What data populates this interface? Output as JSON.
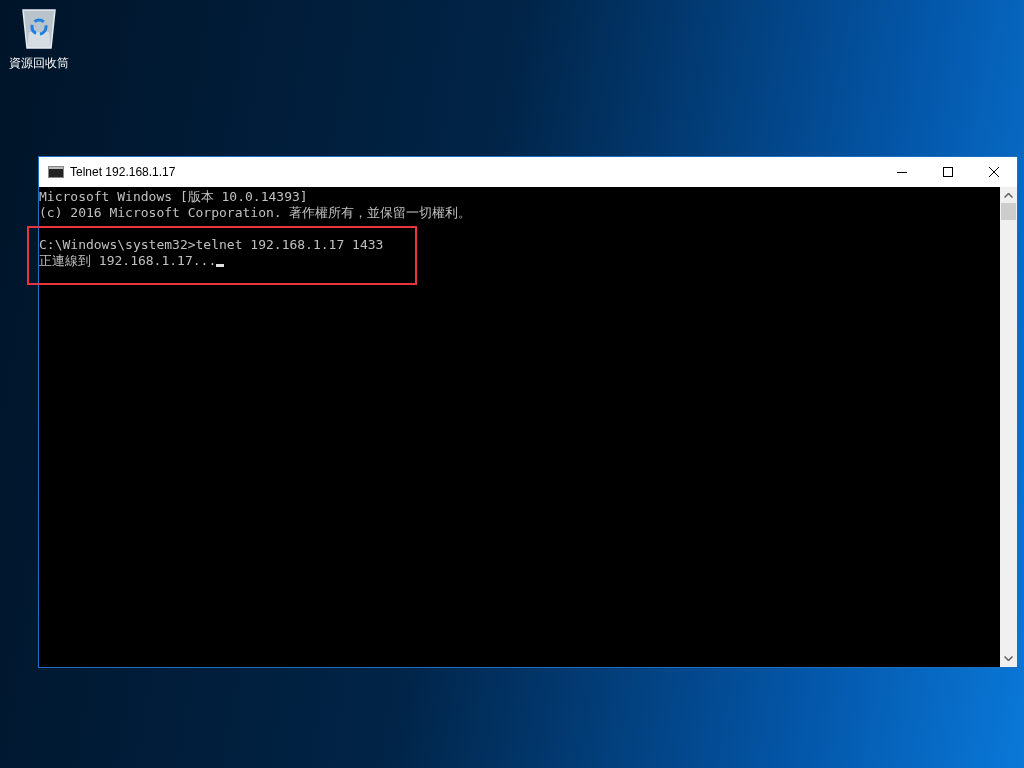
{
  "desktop_icons": [
    {
      "label": "資源回收筒"
    }
  ],
  "window": {
    "title": "Telnet 192.168.1.17",
    "console_blocks": [
      [
        "Microsoft Windows [版本 10.0.14393]",
        "(c) 2016 Microsoft Corporation. 著作權所有，並保留一切權利。"
      ],
      [
        "C:\\Windows\\system32>telnet 192.168.1.17 1433",
        "正連線到 192.168.1.17..."
      ]
    ]
  }
}
